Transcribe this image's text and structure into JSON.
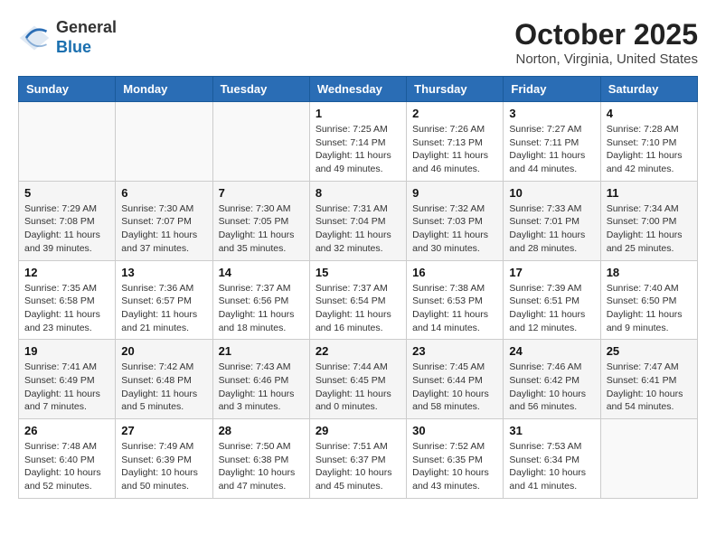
{
  "logo": {
    "general": "General",
    "blue": "Blue"
  },
  "header": {
    "title": "October 2025",
    "location": "Norton, Virginia, United States"
  },
  "weekdays": [
    "Sunday",
    "Monday",
    "Tuesday",
    "Wednesday",
    "Thursday",
    "Friday",
    "Saturday"
  ],
  "weeks": [
    [
      {
        "day": "",
        "info": ""
      },
      {
        "day": "",
        "info": ""
      },
      {
        "day": "",
        "info": ""
      },
      {
        "day": "1",
        "info": "Sunrise: 7:25 AM\nSunset: 7:14 PM\nDaylight: 11 hours and 49 minutes."
      },
      {
        "day": "2",
        "info": "Sunrise: 7:26 AM\nSunset: 7:13 PM\nDaylight: 11 hours and 46 minutes."
      },
      {
        "day": "3",
        "info": "Sunrise: 7:27 AM\nSunset: 7:11 PM\nDaylight: 11 hours and 44 minutes."
      },
      {
        "day": "4",
        "info": "Sunrise: 7:28 AM\nSunset: 7:10 PM\nDaylight: 11 hours and 42 minutes."
      }
    ],
    [
      {
        "day": "5",
        "info": "Sunrise: 7:29 AM\nSunset: 7:08 PM\nDaylight: 11 hours and 39 minutes."
      },
      {
        "day": "6",
        "info": "Sunrise: 7:30 AM\nSunset: 7:07 PM\nDaylight: 11 hours and 37 minutes."
      },
      {
        "day": "7",
        "info": "Sunrise: 7:30 AM\nSunset: 7:05 PM\nDaylight: 11 hours and 35 minutes."
      },
      {
        "day": "8",
        "info": "Sunrise: 7:31 AM\nSunset: 7:04 PM\nDaylight: 11 hours and 32 minutes."
      },
      {
        "day": "9",
        "info": "Sunrise: 7:32 AM\nSunset: 7:03 PM\nDaylight: 11 hours and 30 minutes."
      },
      {
        "day": "10",
        "info": "Sunrise: 7:33 AM\nSunset: 7:01 PM\nDaylight: 11 hours and 28 minutes."
      },
      {
        "day": "11",
        "info": "Sunrise: 7:34 AM\nSunset: 7:00 PM\nDaylight: 11 hours and 25 minutes."
      }
    ],
    [
      {
        "day": "12",
        "info": "Sunrise: 7:35 AM\nSunset: 6:58 PM\nDaylight: 11 hours and 23 minutes."
      },
      {
        "day": "13",
        "info": "Sunrise: 7:36 AM\nSunset: 6:57 PM\nDaylight: 11 hours and 21 minutes."
      },
      {
        "day": "14",
        "info": "Sunrise: 7:37 AM\nSunset: 6:56 PM\nDaylight: 11 hours and 18 minutes."
      },
      {
        "day": "15",
        "info": "Sunrise: 7:37 AM\nSunset: 6:54 PM\nDaylight: 11 hours and 16 minutes."
      },
      {
        "day": "16",
        "info": "Sunrise: 7:38 AM\nSunset: 6:53 PM\nDaylight: 11 hours and 14 minutes."
      },
      {
        "day": "17",
        "info": "Sunrise: 7:39 AM\nSunset: 6:51 PM\nDaylight: 11 hours and 12 minutes."
      },
      {
        "day": "18",
        "info": "Sunrise: 7:40 AM\nSunset: 6:50 PM\nDaylight: 11 hours and 9 minutes."
      }
    ],
    [
      {
        "day": "19",
        "info": "Sunrise: 7:41 AM\nSunset: 6:49 PM\nDaylight: 11 hours and 7 minutes."
      },
      {
        "day": "20",
        "info": "Sunrise: 7:42 AM\nSunset: 6:48 PM\nDaylight: 11 hours and 5 minutes."
      },
      {
        "day": "21",
        "info": "Sunrise: 7:43 AM\nSunset: 6:46 PM\nDaylight: 11 hours and 3 minutes."
      },
      {
        "day": "22",
        "info": "Sunrise: 7:44 AM\nSunset: 6:45 PM\nDaylight: 11 hours and 0 minutes."
      },
      {
        "day": "23",
        "info": "Sunrise: 7:45 AM\nSunset: 6:44 PM\nDaylight: 10 hours and 58 minutes."
      },
      {
        "day": "24",
        "info": "Sunrise: 7:46 AM\nSunset: 6:42 PM\nDaylight: 10 hours and 56 minutes."
      },
      {
        "day": "25",
        "info": "Sunrise: 7:47 AM\nSunset: 6:41 PM\nDaylight: 10 hours and 54 minutes."
      }
    ],
    [
      {
        "day": "26",
        "info": "Sunrise: 7:48 AM\nSunset: 6:40 PM\nDaylight: 10 hours and 52 minutes."
      },
      {
        "day": "27",
        "info": "Sunrise: 7:49 AM\nSunset: 6:39 PM\nDaylight: 10 hours and 50 minutes."
      },
      {
        "day": "28",
        "info": "Sunrise: 7:50 AM\nSunset: 6:38 PM\nDaylight: 10 hours and 47 minutes."
      },
      {
        "day": "29",
        "info": "Sunrise: 7:51 AM\nSunset: 6:37 PM\nDaylight: 10 hours and 45 minutes."
      },
      {
        "day": "30",
        "info": "Sunrise: 7:52 AM\nSunset: 6:35 PM\nDaylight: 10 hours and 43 minutes."
      },
      {
        "day": "31",
        "info": "Sunrise: 7:53 AM\nSunset: 6:34 PM\nDaylight: 10 hours and 41 minutes."
      },
      {
        "day": "",
        "info": ""
      }
    ]
  ]
}
